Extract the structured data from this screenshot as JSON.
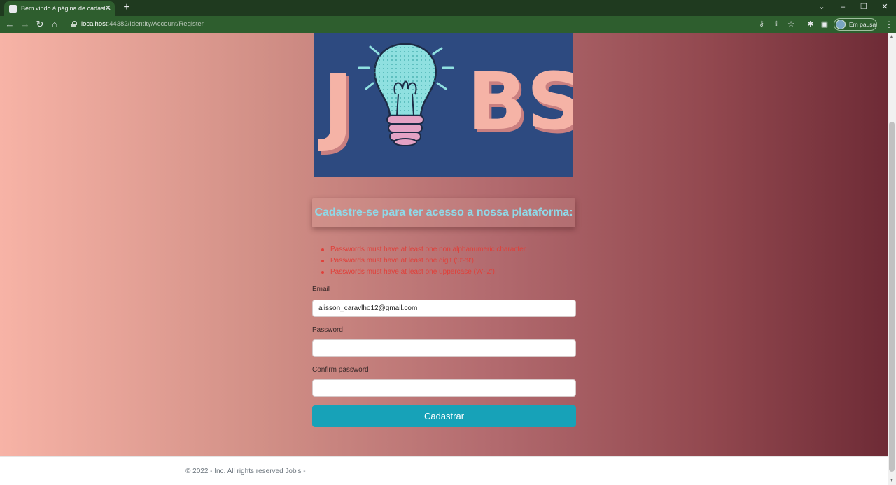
{
  "browser": {
    "tab_title": "Bem vindo à página de cadastro!",
    "url_host": "localhost",
    "url_rest": ":44382/Identity/Account/Register",
    "profile_label": "Em pausa"
  },
  "logo": {
    "text": "JOBS"
  },
  "form": {
    "heading": "Cadastre-se para ter acesso a nossa plataforma:",
    "errors": [
      "Passwords must have at least one non alphanumeric character.",
      "Passwords must have at least one digit ('0'-'9').",
      "Passwords must have at least one uppercase ('A'-'Z')."
    ],
    "email_label": "Email",
    "email_value": "alisson_caravlho12@gmail.com",
    "password_label": "Password",
    "password_value": "",
    "confirm_label": "Confirm password",
    "confirm_value": "",
    "submit_label": "Cadastrar"
  },
  "footer": {
    "text": "© 2022 - Inc. All rights reserved Job's -"
  },
  "colors": {
    "heading": "#8fd9e8",
    "error": "#e0403a",
    "submit": "#17a2b8",
    "logo_bg": "#2d4a80",
    "logo_letters": "#f5b3a6"
  }
}
